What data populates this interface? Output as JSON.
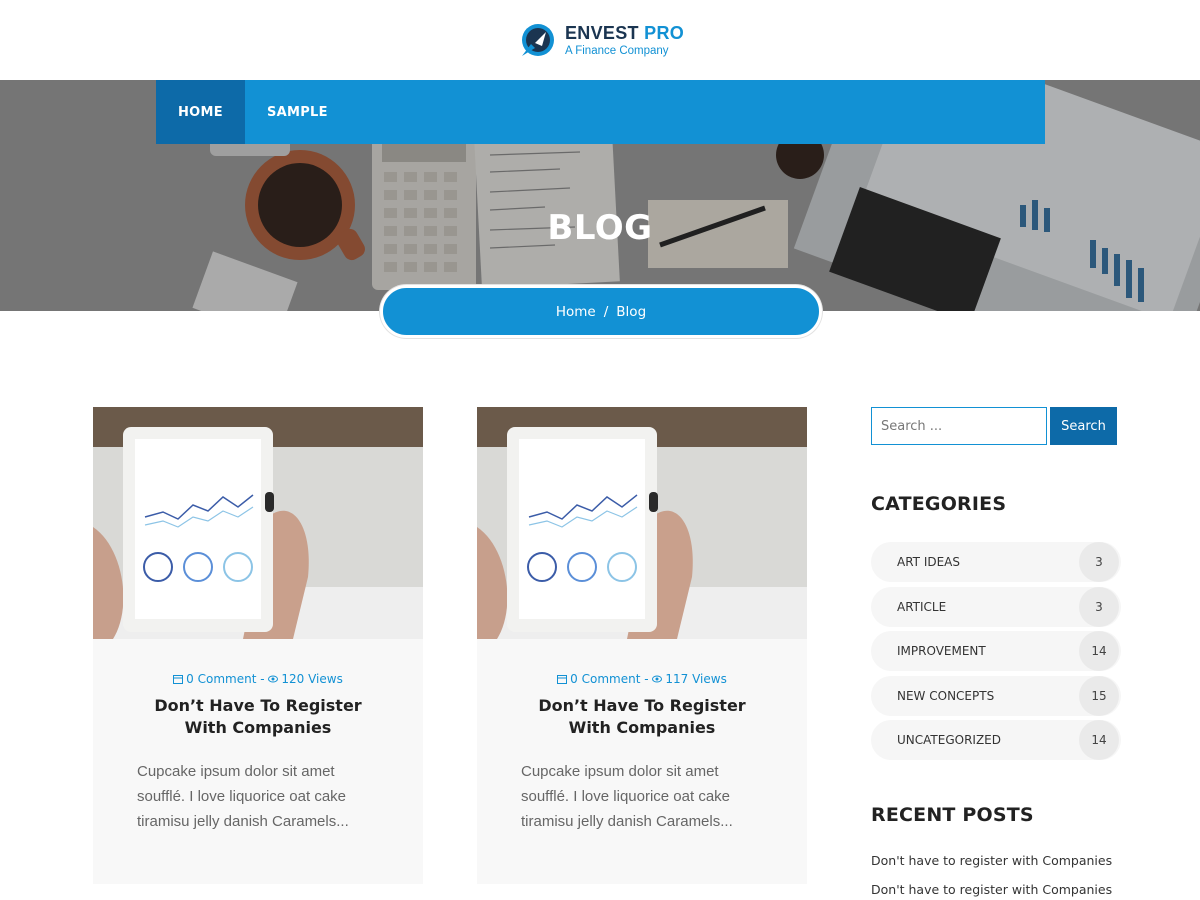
{
  "brand": {
    "name_main": "ENVEST",
    "name_accent": "PRO",
    "tagline": "A Finance Company",
    "primary_color": "#1291d4",
    "dark_color": "#0d6aa8"
  },
  "nav": {
    "items": [
      {
        "label": "HOME",
        "active": true
      },
      {
        "label": "SAMPLE",
        "active": false
      }
    ]
  },
  "hero": {
    "title": "BLOG"
  },
  "breadcrumb": {
    "items": [
      "Home",
      "Blog"
    ],
    "separator": "/"
  },
  "posts": [
    {
      "comments": "0 Comment -",
      "views": "120 Views",
      "title": "Don’t Have To Register With Companies",
      "excerpt": "Cupcake ipsum dolor sit amet soufflé. I love liquorice oat cake tiramisu jelly danish Caramels..."
    },
    {
      "comments": "0 Comment -",
      "views": "117 Views",
      "title": "Don’t Have To Register With Companies",
      "excerpt": "Cupcake ipsum dolor sit amet soufflé. I love liquorice oat cake tiramisu jelly danish Caramels..."
    }
  ],
  "sidebar": {
    "search": {
      "placeholder": "Search ...",
      "button_label": "Search"
    },
    "categories": {
      "title": "CATEGORIES",
      "items": [
        {
          "label": "ART IDEAS",
          "count": "3"
        },
        {
          "label": "ARTICLE",
          "count": "3"
        },
        {
          "label": "IMPROVEMENT",
          "count": "14"
        },
        {
          "label": "NEW CONCEPTS",
          "count": "15"
        },
        {
          "label": "UNCATEGORIZED",
          "count": "14"
        }
      ]
    },
    "recent": {
      "title": "RECENT POSTS",
      "items": [
        "Don't have to register with Companies",
        "Don't have to register with Companies"
      ]
    }
  },
  "icons": {
    "comment": "calendar-icon",
    "views": "eye-icon"
  }
}
